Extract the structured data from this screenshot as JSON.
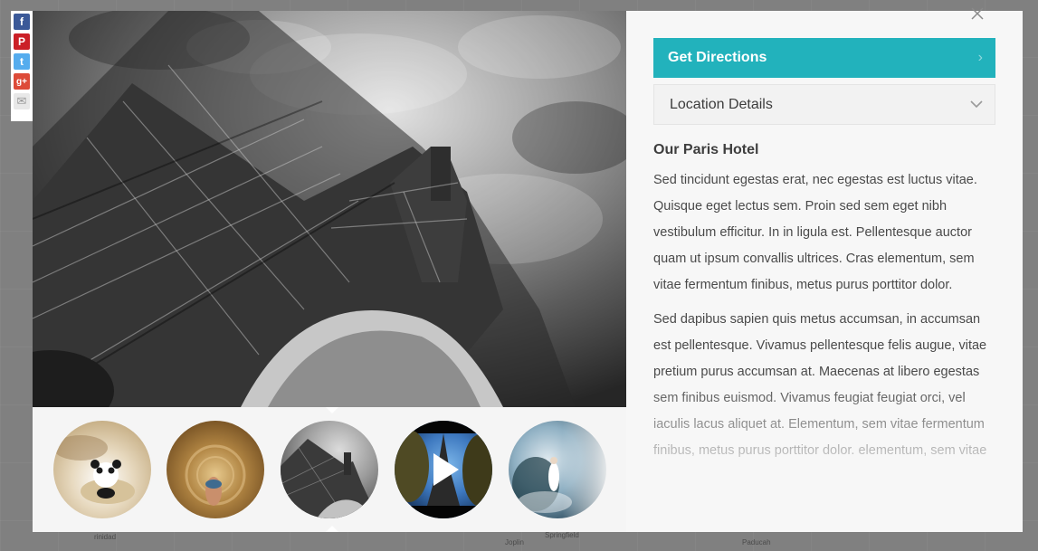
{
  "share": [
    {
      "network": "facebook",
      "icon": "facebook-icon",
      "glyph": "f",
      "color": "#3b5998"
    },
    {
      "network": "pinterest",
      "icon": "pinterest-icon",
      "glyph": "P",
      "color": "#cb2027"
    },
    {
      "network": "twitter",
      "icon": "twitter-icon",
      "glyph": "t",
      "color": "#55acee"
    },
    {
      "network": "google-plus",
      "icon": "google-plus-icon",
      "glyph": "g+",
      "color": "#dd4b39"
    },
    {
      "network": "email",
      "icon": "email-icon",
      "glyph": "✉",
      "color": "#bdbdbd"
    }
  ],
  "map_labels": [
    "rinidad",
    "Joplin",
    "Springfield",
    "Paducah"
  ],
  "gallery": {
    "active_index": 2,
    "thumbnails": [
      {
        "label": "panda-photo",
        "has_video": false
      },
      {
        "label": "tunnel-photo",
        "has_video": false
      },
      {
        "label": "eiffel-tower-photo",
        "has_video": false
      },
      {
        "label": "eiffel-video",
        "has_video": true
      },
      {
        "label": "waterfall-photo",
        "has_video": false
      }
    ]
  },
  "panel": {
    "directions_label": "Get Directions",
    "details_label": "Location Details",
    "title": "Our Paris Hotel",
    "paragraphs": [
      "Sed tincidunt egestas erat, nec egestas est luctus vitae. Quisque eget lectus sem. Proin sed sem eget nibh vestibulum efficitur. In in ligula est. Pellentesque auctor quam ut ipsum convallis ultrices. Cras elementum, sem vitae fermentum finibus, metus purus porttitor dolor.",
      "Sed dapibus sapien quis metus accumsan, in accumsan est pellentesque. Vivamus pellentesque felis augue, vitae pretium purus accumsan at. Maecenas at libero egestas sem finibus euismod. Vivamus feugiat feugiat orci, vel iaculis lacus aliquet at. Elementum, sem vitae fermentum finibus, metus purus porttitor dolor. elementum, sem vitae"
    ]
  },
  "colors": {
    "accent": "#22b2bc",
    "text": "#4a4a4a",
    "panel_bg": "#f7f7f7"
  }
}
